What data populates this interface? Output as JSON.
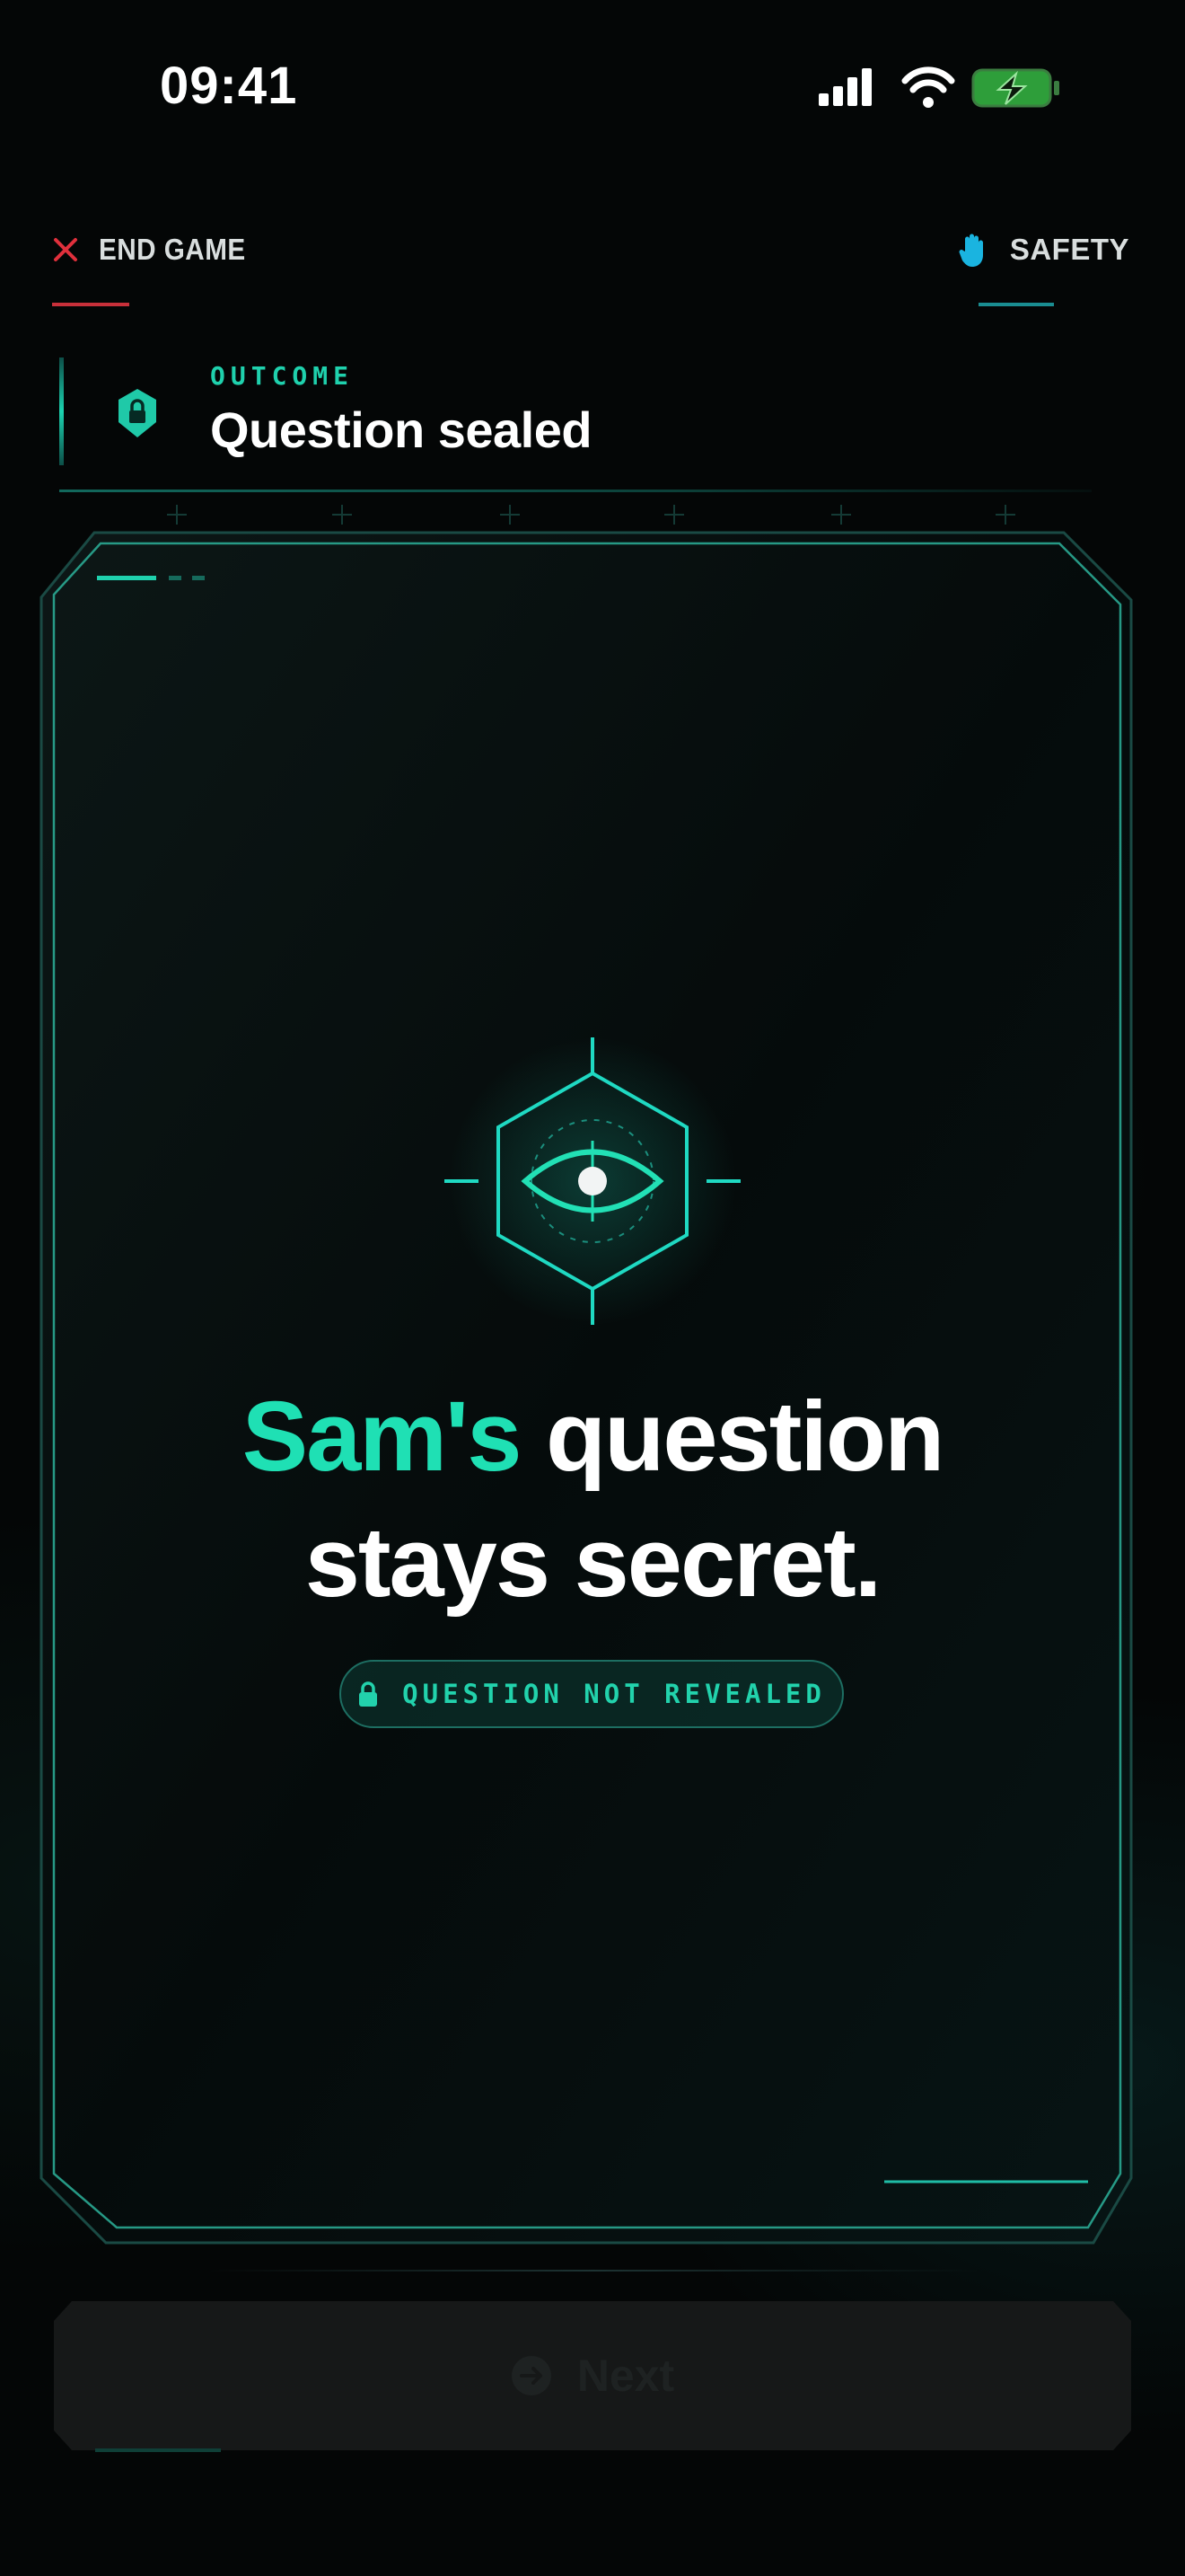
{
  "status_bar": {
    "time": "09:41"
  },
  "nav": {
    "end_game_label": "END GAME",
    "safety_label": "SAFETY"
  },
  "outcome": {
    "kicker": "OUTCOME",
    "title": "Question sealed"
  },
  "card": {
    "headline_name": "Sam's",
    "headline_rest_line1": " question",
    "headline_line2": "stays secret.",
    "badge_label": "QUESTION NOT REVEALED",
    "emblem_icon": "eye-hexagon-icon"
  },
  "footer": {
    "next_label": "Next",
    "next_icon": "arrow-circle-right-icon"
  },
  "colors": {
    "accent": "#1fe0b4",
    "danger": "#c8303a",
    "safety": "#1aa8c8",
    "background": "#040606"
  }
}
